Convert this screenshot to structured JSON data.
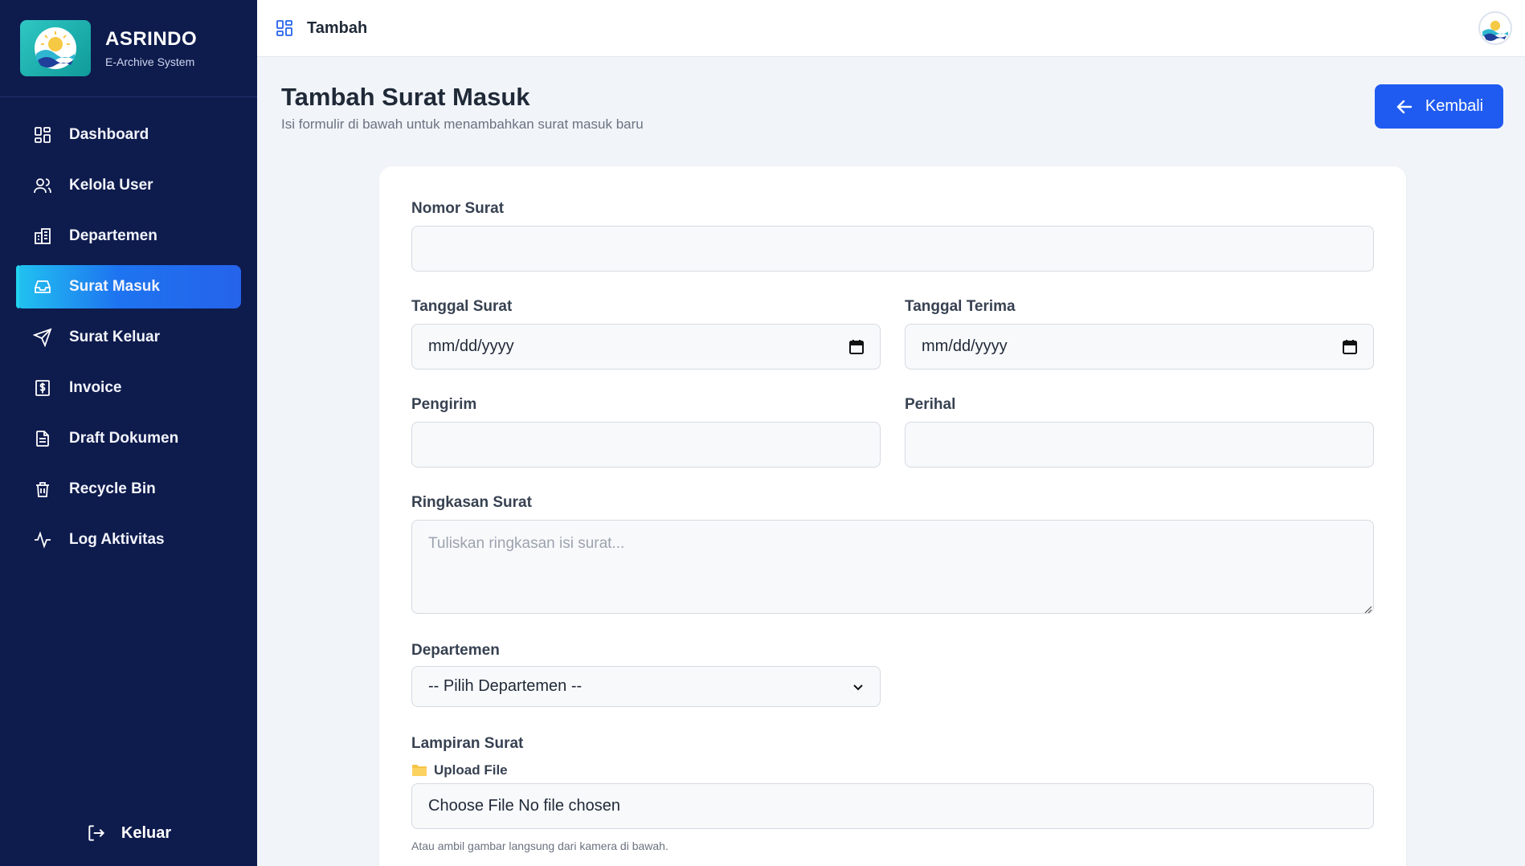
{
  "brand": {
    "name": "ASRINDO",
    "subtitle": "E-Archive System"
  },
  "sidebar": {
    "items": [
      {
        "label": "Dashboard",
        "icon": "dashboard-icon"
      },
      {
        "label": "Kelola User",
        "icon": "users-icon"
      },
      {
        "label": "Departemen",
        "icon": "building-icon"
      },
      {
        "label": "Surat Masuk",
        "icon": "inbox-icon",
        "active": true
      },
      {
        "label": "Surat Keluar",
        "icon": "send-icon"
      },
      {
        "label": "Invoice",
        "icon": "invoice-icon"
      },
      {
        "label": "Draft Dokumen",
        "icon": "document-icon"
      },
      {
        "label": "Recycle Bin",
        "icon": "trash-icon"
      },
      {
        "label": "Log Aktivitas",
        "icon": "activity-icon"
      }
    ],
    "logout_label": "Keluar"
  },
  "topbar": {
    "breadcrumb": "Tambah"
  },
  "page": {
    "title": "Tambah Surat Masuk",
    "subtitle": "Isi formulir di bawah untuk menambahkan surat masuk baru",
    "back_label": "Kembali"
  },
  "form": {
    "nomor_surat": {
      "label": "Nomor Surat",
      "value": ""
    },
    "tanggal_surat": {
      "label": "Tanggal Surat",
      "value": "mm/dd/yyyy"
    },
    "tanggal_terima": {
      "label": "Tanggal Terima",
      "value": "mm/dd/yyyy"
    },
    "pengirim": {
      "label": "Pengirim",
      "value": ""
    },
    "perihal": {
      "label": "Perihal",
      "value": ""
    },
    "ringkasan": {
      "label": "Ringkasan Surat",
      "placeholder": "Tuliskan ringkasan isi surat..."
    },
    "departemen": {
      "label": "Departemen",
      "selected": "-- Pilih Departemen --"
    },
    "lampiran": {
      "label": "Lampiran Surat",
      "upload_label": "Upload File",
      "file_text": "Choose File No file chosen",
      "hint": "Atau ambil gambar langsung dari kamera di bawah."
    }
  },
  "colors": {
    "sidebar_bg": "#0e1b4d",
    "accent": "#1f5bf0",
    "active_gradient_start": "#21c3f0"
  }
}
